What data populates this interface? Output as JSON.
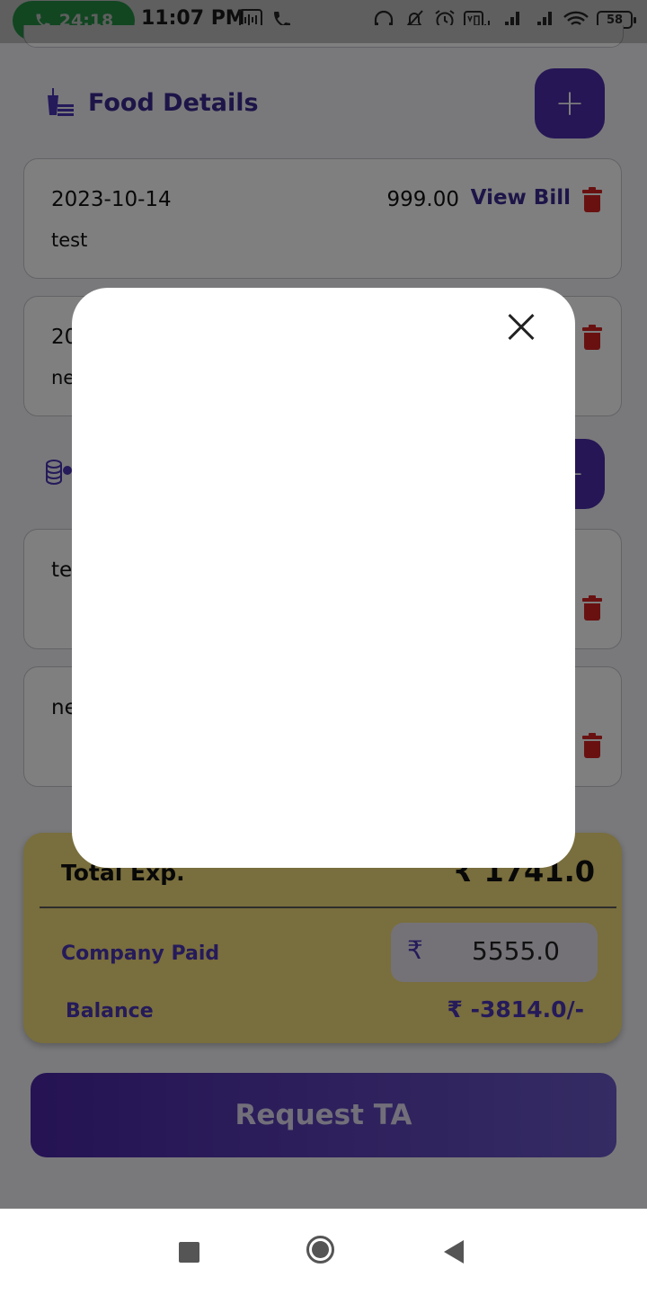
{
  "status_bar": {
    "call_timer": "24:18",
    "time": "11:07 PM",
    "battery": "58"
  },
  "food_section": {
    "title": "Food Details",
    "add_label": "+",
    "items": [
      {
        "date": "2023-10-14",
        "amount": "999.00",
        "view_bill": "View Bill",
        "description": "test"
      },
      {
        "date": "20",
        "description": "ne"
      }
    ]
  },
  "second_section": {
    "add_label": "+",
    "items": [
      {
        "description": "tes"
      },
      {
        "description": "ne"
      }
    ]
  },
  "totals": {
    "total_label": "Total Exp.",
    "total_value": "₹ 1741.0",
    "company_paid_label": "Company Paid",
    "currency_symbol": "₹",
    "company_paid_value": "5555.0",
    "balance_label": "Balance",
    "balance_value": "₹ -3814.0/-"
  },
  "request_button": "Request TA",
  "colors": {
    "accent": "#4c2dab",
    "totals_bg": "#f2dd7b",
    "delete": "#d32222"
  }
}
